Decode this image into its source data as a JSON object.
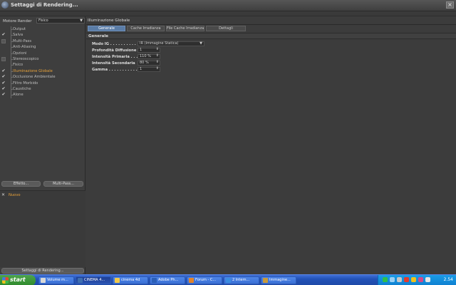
{
  "window": {
    "title": "Settaggi di Rendering...",
    "close_label": "×"
  },
  "left": {
    "renderer_label": "Motore Render",
    "renderer_value": "Fisico",
    "options": [
      {
        "label": "Output",
        "checked": false,
        "checkbox": false,
        "active": false
      },
      {
        "label": "Salva",
        "checked": true,
        "checkbox": false,
        "active": false
      },
      {
        "label": "Multi-Pass",
        "checked": false,
        "checkbox": true,
        "active": false
      },
      {
        "label": "Anti-Aliasing",
        "checked": false,
        "checkbox": false,
        "active": false
      },
      {
        "label": "Opzioni",
        "checked": false,
        "checkbox": false,
        "active": false
      },
      {
        "label": "Stereoscopico",
        "checked": false,
        "checkbox": true,
        "active": false
      },
      {
        "label": "Fisico",
        "checked": false,
        "checkbox": false,
        "active": false
      },
      {
        "label": "Illuminazione Globale",
        "checked": true,
        "checkbox": false,
        "active": true
      },
      {
        "label": "Occlusione Ambientale",
        "checked": true,
        "checkbox": false,
        "active": false
      },
      {
        "label": "Filtro Morbido",
        "checked": true,
        "checkbox": false,
        "active": false
      },
      {
        "label": "Caustiche",
        "checked": true,
        "checkbox": false,
        "active": false
      },
      {
        "label": "Alone",
        "checked": true,
        "checkbox": false,
        "active": false
      }
    ],
    "effects_button": "Effetto...",
    "multipass_button": "Multi-Pass...",
    "preset_label": "Nuovo",
    "preset_check": "✕",
    "render_settings_button": "Settaggi di Rendering..."
  },
  "main": {
    "section_title": "Illuminazione Globale",
    "tabs": [
      "Generale",
      "Cache Irradianza",
      "File Cache Irradianza",
      "Dettagli"
    ],
    "group_title": "Generale",
    "params": [
      {
        "label": "Modo IG . . . . . . . . . . . .",
        "value": "IR (Immagine Statica)",
        "type": "select"
      },
      {
        "label": "Profondità Diffusione",
        "value": "1",
        "type": "spin"
      },
      {
        "label": "Intensità Primaria . . . .",
        "value": "110 %",
        "type": "spin"
      },
      {
        "label": "Intensità Secondaria",
        "value": "80 %",
        "type": "spin"
      },
      {
        "label": "Gamma . . . . . . . . . . . . . .",
        "value": "1",
        "type": "spin"
      }
    ]
  },
  "taskbar": {
    "start_label": "start",
    "tasks": [
      "Volume m...",
      "CINEMA 4...",
      "cinema 4d",
      "Adobe Ph...",
      "Forum - C...",
      "2 Intern...",
      "Immagine..."
    ],
    "active_task": 1,
    "clock": "2.54"
  }
}
